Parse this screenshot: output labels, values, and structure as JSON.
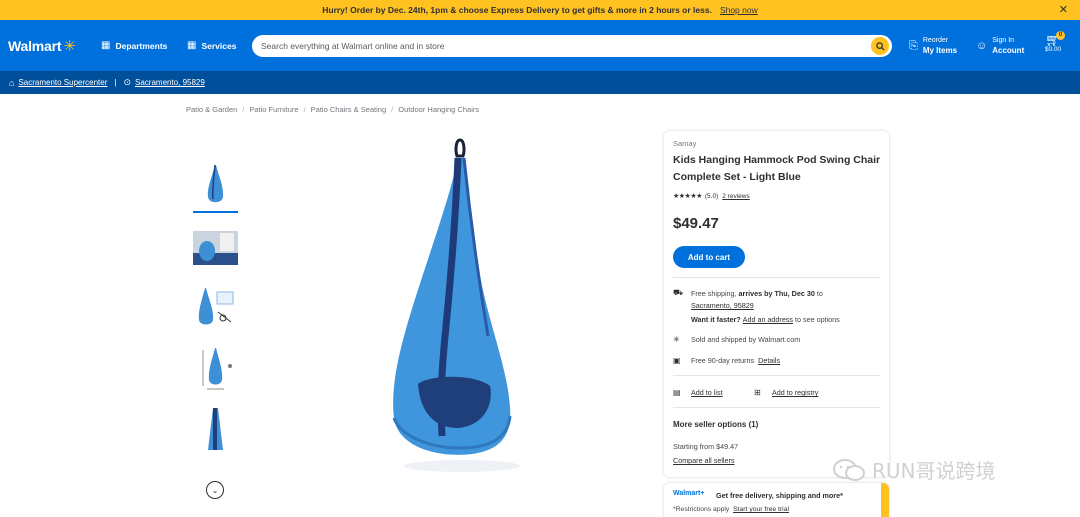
{
  "promo": {
    "text": "Hurry! Order by Dec. 24th, 1pm & choose Express Delivery to get gifts & more in 2 hours or less.",
    "link": "Shop now",
    "close": "✕"
  },
  "header": {
    "logo": "Walmart",
    "departments": "Departments",
    "services": "Services",
    "search_placeholder": "Search everything at Walmart online and in store",
    "reorder_top": "Reorder",
    "reorder_bottom": "My Items",
    "signin_top": "Sign In",
    "signin_bottom": "Account",
    "cart_count": "0",
    "cart_total": "$0.00"
  },
  "location": {
    "store": "Sacramento Supercenter",
    "address": "Sacramento, 95829"
  },
  "breadcrumbs": [
    "Patio & Garden",
    "Patio Furniture",
    "Patio Chairs & Seating",
    "Outdoor Hanging Chairs"
  ],
  "product": {
    "brand": "Samay",
    "title": "Kids Hanging Hammock Pod Swing Chair Complete Set - Light Blue",
    "stars": "★★★★★",
    "rating": "(5.0)",
    "reviews": "2 reviews",
    "price": "$49.47",
    "add_to_cart": "Add to cart",
    "shipping_prefix": "Free shipping,",
    "shipping_arrives": "arrives by Thu, Dec 30",
    "shipping_to": "to",
    "shipping_address": "Sacramento, 95829",
    "faster_q": "Want it faster?",
    "faster_link": "Add an address",
    "faster_suffix": "to see options",
    "sold_by": "Sold and shipped by Walmart.com",
    "returns": "Free 90-day returns",
    "returns_link": "Details",
    "add_to_list": "Add to list",
    "add_to_registry": "Add to registry",
    "more_sellers": "More seller options (1)",
    "starting_from": "Starting from $49.47",
    "compare": "Compare all sellers"
  },
  "wplus": {
    "logo": "Walmart+",
    "headline": "Get free delivery, shipping and more*",
    "restrictions": "*Restrictions apply",
    "trial": "Start your free trial"
  },
  "watermark": "RUN哥说跨境",
  "colors": {
    "walmart_blue": "#0071dc",
    "spark_yellow": "#ffc220",
    "dark_blue": "#004f9a"
  }
}
